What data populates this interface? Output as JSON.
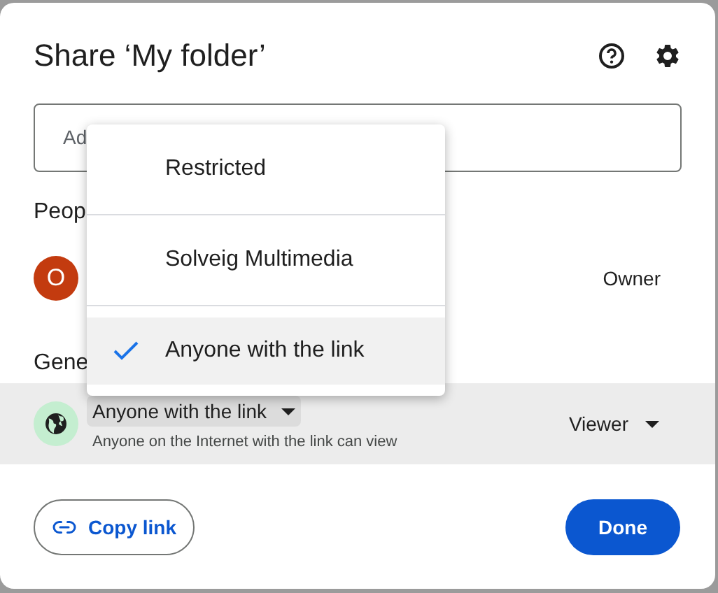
{
  "dialog": {
    "title": "Share ‘My folder’",
    "add_field": {
      "placeholder": "Ad"
    },
    "people_heading": "Peop",
    "people": [
      {
        "initial": "O",
        "role": "Owner"
      }
    ],
    "general_heading": "Gene",
    "general_access": {
      "access": "Anyone with the link",
      "description": "Anyone on the Internet with the link can view",
      "role": "Viewer"
    },
    "access_menu": [
      {
        "label": "Restricted",
        "selected": false
      },
      {
        "label": "Solveig Multimedia",
        "selected": false
      },
      {
        "label": "Anyone with the link",
        "selected": true
      }
    ],
    "buttons": {
      "copy_link": "Copy link",
      "done": "Done"
    }
  }
}
